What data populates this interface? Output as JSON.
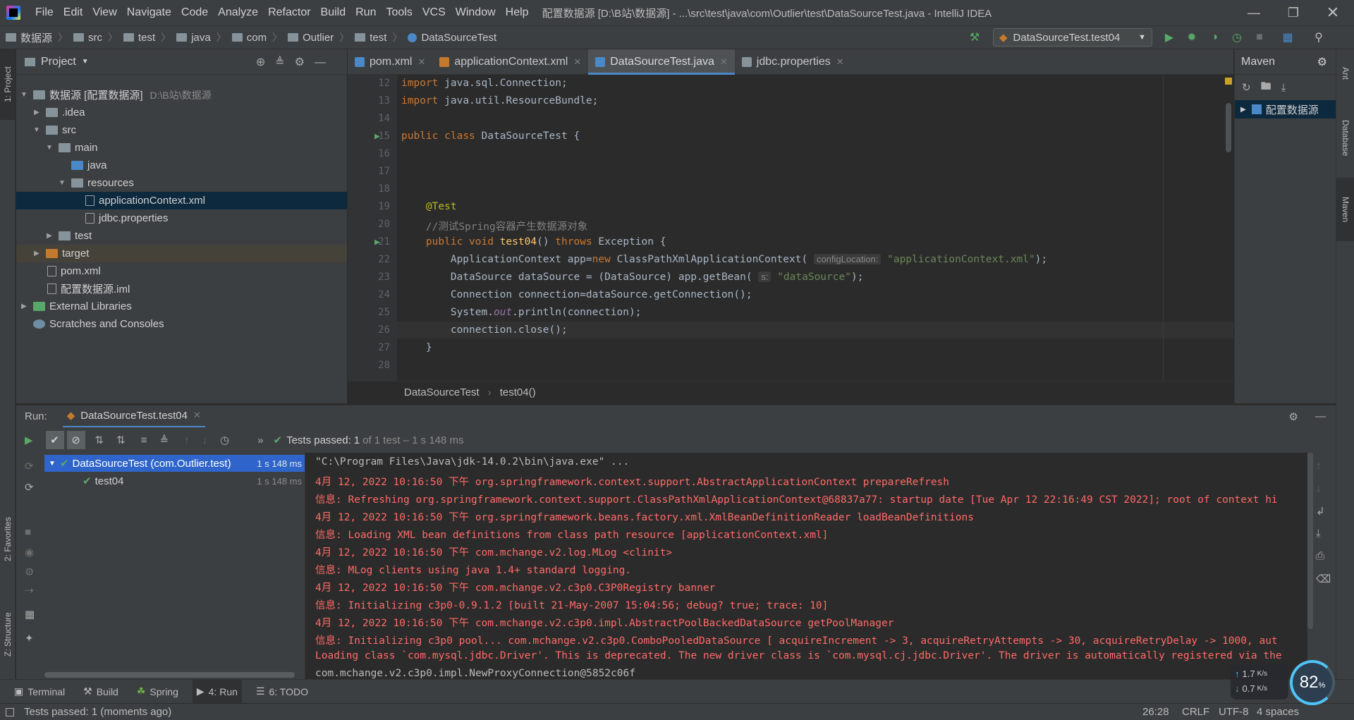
{
  "window": {
    "title": "配置数据源 [D:\\B站\\数据源] - ...\\src\\test\\java\\com\\Outlier\\test\\DataSourceTest.java - IntelliJ IDEA"
  },
  "menu": [
    "File",
    "Edit",
    "View",
    "Navigate",
    "Code",
    "Analyze",
    "Refactor",
    "Build",
    "Run",
    "Tools",
    "VCS",
    "Window",
    "Help"
  ],
  "breadcrumbs": [
    "数据源",
    "src",
    "test",
    "java",
    "com",
    "Outlier",
    "test",
    "DataSourceTest"
  ],
  "run_config": "DataSourceTest.test04",
  "left_strip": {
    "project": "1: Project",
    "favorites": "2: Favorites",
    "structure": "Z: Structure"
  },
  "right_strip": {
    "ant": "Ant",
    "database": "Database",
    "maven": "Maven"
  },
  "project": {
    "title": "Project",
    "tree": [
      {
        "label": "数据源 [配置数据源]",
        "extra": "D:\\B站\\数据源",
        "depth": 0,
        "arrow": "▼",
        "kind": "folder"
      },
      {
        "label": ".idea",
        "depth": 1,
        "arrow": "▶",
        "kind": "folder"
      },
      {
        "label": "src",
        "depth": 1,
        "arrow": "▼",
        "kind": "folder"
      },
      {
        "label": "main",
        "depth": 2,
        "arrow": "▼",
        "kind": "folder"
      },
      {
        "label": "java",
        "depth": 3,
        "arrow": "",
        "kind": "folder-blue"
      },
      {
        "label": "resources",
        "depth": 3,
        "arrow": "▼",
        "kind": "folder"
      },
      {
        "label": "applicationContext.xml",
        "depth": 4,
        "arrow": "",
        "kind": "file",
        "selected": true
      },
      {
        "label": "jdbc.properties",
        "depth": 4,
        "arrow": "",
        "kind": "file"
      },
      {
        "label": "test",
        "depth": 2,
        "arrow": "▶",
        "kind": "folder"
      },
      {
        "label": "target",
        "depth": 1,
        "arrow": "▶",
        "kind": "folder-orange",
        "highlight": true
      },
      {
        "label": "pom.xml",
        "depth": 1,
        "arrow": "",
        "kind": "file"
      },
      {
        "label": "配置数据源.iml",
        "depth": 1,
        "arrow": "",
        "kind": "file"
      },
      {
        "label": "External Libraries",
        "depth": 0,
        "arrow": "▶",
        "kind": "lib"
      },
      {
        "label": "Scratches and Consoles",
        "depth": 0,
        "arrow": "",
        "kind": "scratch"
      }
    ]
  },
  "tabs": [
    {
      "label": "pom.xml",
      "color": "#4a88c7",
      "active": false
    },
    {
      "label": "applicationContext.xml",
      "color": "#c47a2e",
      "active": false
    },
    {
      "label": "DataSourceTest.java",
      "color": "#4a88c7",
      "active": true
    },
    {
      "label": "jdbc.properties",
      "color": "#87939a",
      "active": false
    }
  ],
  "editor": {
    "line_numbers": [
      "12",
      "13",
      "14",
      "15",
      "16",
      "17",
      "18",
      "19",
      "20",
      "21",
      "22",
      "23",
      "24",
      "25",
      "26",
      "27",
      "28"
    ],
    "line12": "java.sql.Connection;",
    "line13": "java.util.ResourceBundle;",
    "kw_import": "import",
    "kw_public": "public",
    "kw_class": "class",
    "class_name": "DataSourceTest {",
    "annotation": "@Test",
    "comment": "//测试Spring容器产生数据源对象",
    "kw_void": "void",
    "method_name": "test04",
    "method_rest": "() ",
    "kw_throws": "throws",
    "exception": " Exception {",
    "l22_a": "ApplicationContext app=",
    "kw_new": "new",
    "l22_b": " ClassPathXmlApplicationContext(",
    "hint_config": "configLocation:",
    "str_ctx": "\"applicationContext.xml\"",
    "l22_c": ");",
    "l23_a": "DataSource dataSource = (DataSource) app.getBean(",
    "hint_s": "s:",
    "str_ds": "\"dataSource\"",
    "l23_c": ");",
    "l24": "Connection connection=dataSource.getConnection();",
    "l25_a": "System.",
    "l25_out": "out",
    "l25_b": ".println(connection);",
    "l26": "connection.close();",
    "l27": "}",
    "crumb_class": "DataSourceTest",
    "crumb_method": "test04()"
  },
  "maven": {
    "title": "Maven",
    "root": "配置数据源"
  },
  "run": {
    "label": "Run:",
    "tab": "DataSourceTest.test04",
    "status": "Tests passed:",
    "status_count": "1",
    "status_rest": "of 1 test – 1 s 148 ms",
    "tree": [
      {
        "label": "DataSourceTest (com.Outlier.test)",
        "time": "1 s 148 ms"
      },
      {
        "label": "test04",
        "time": "1 s 148 ms"
      }
    ],
    "console": [
      {
        "text": "\"C:\\Program Files\\Java\\jdk-14.0.2\\bin\\java.exe\" ...",
        "gray": true
      },
      {
        "text": "4月 12, 2022 10:16:50 下午 org.springframework.context.support.AbstractApplicationContext prepareRefresh"
      },
      {
        "text": "信息: Refreshing org.springframework.context.support.ClassPathXmlApplicationContext@68837a77: startup date [Tue Apr 12 22:16:49 CST 2022]; root of context hi"
      },
      {
        "text": "4月 12, 2022 10:16:50 下午 org.springframework.beans.factory.xml.XmlBeanDefinitionReader loadBeanDefinitions"
      },
      {
        "text": "信息: Loading XML bean definitions from class path resource [applicationContext.xml]"
      },
      {
        "text": "4月 12, 2022 10:16:50 下午 com.mchange.v2.log.MLog <clinit>"
      },
      {
        "text": "信息: MLog clients using java 1.4+ standard logging."
      },
      {
        "text": "4月 12, 2022 10:16:50 下午 com.mchange.v2.c3p0.C3P0Registry banner"
      },
      {
        "text": "信息: Initializing c3p0-0.9.1.2 [built 21-May-2007 15:04:56; debug? true; trace: 10]"
      },
      {
        "text": "4月 12, 2022 10:16:50 下午 com.mchange.v2.c3p0.impl.AbstractPoolBackedDataSource getPoolManager"
      },
      {
        "text": "信息: Initializing c3p0 pool... com.mchange.v2.c3p0.ComboPooledDataSource [ acquireIncrement -> 3, acquireRetryAttempts -> 30, acquireRetryDelay -> 1000, aut"
      },
      {
        "text": "Loading class `com.mysql.jdbc.Driver'. This is deprecated. The new driver class is `com.mysql.cj.jdbc.Driver'. The driver is automatically registered via the"
      },
      {
        "text": "com.mchange.v2.c3p0.impl.NewProxyConnection@5852c06f",
        "gray": true
      }
    ]
  },
  "toolwindows": [
    {
      "label": "Terminal",
      "icon": "terminal-icon"
    },
    {
      "label": "Build",
      "icon": "hammer-icon"
    },
    {
      "label": "Spring",
      "icon": "spring-icon"
    },
    {
      "label": "4: Run",
      "icon": "run-icon",
      "active": true
    },
    {
      "label": "6: TODO",
      "icon": "todo-icon"
    }
  ],
  "statusbar": {
    "message": "Tests passed: 1 (moments ago)",
    "position": "26:28",
    "line_sep": "CRLF",
    "encoding": "UTF-8",
    "indent": "4 spaces"
  },
  "network": {
    "up": "1.7",
    "down": "0.7",
    "unit": "K/s",
    "percent": "82",
    "pct_sign": "%"
  }
}
